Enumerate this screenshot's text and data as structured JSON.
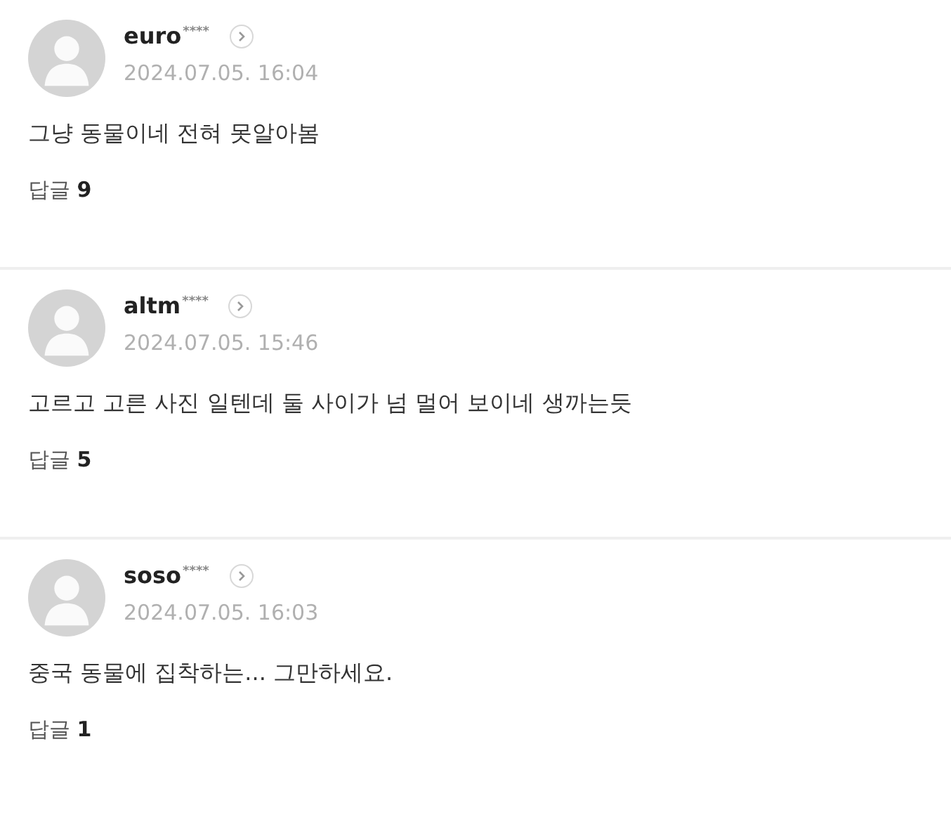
{
  "comments": [
    {
      "user": "euro",
      "mask": "****",
      "date": "2024.07.05. 16:04",
      "text": "그냥 동물이네 전혀 못알아봄",
      "reply_label": "답글",
      "reply_count": "9"
    },
    {
      "user": "altm",
      "mask": "****",
      "date": "2024.07.05. 15:46",
      "text": "고르고 고른 사진 일텐데 둘 사이가 넘 멀어 보이네 생까는듯",
      "reply_label": "답글",
      "reply_count": "5"
    },
    {
      "user": "soso",
      "mask": "****",
      "date": "2024.07.05. 16:03",
      "text": "중국 동물에 집착하는... 그만하세요.",
      "reply_label": "답글",
      "reply_count": "1"
    }
  ]
}
